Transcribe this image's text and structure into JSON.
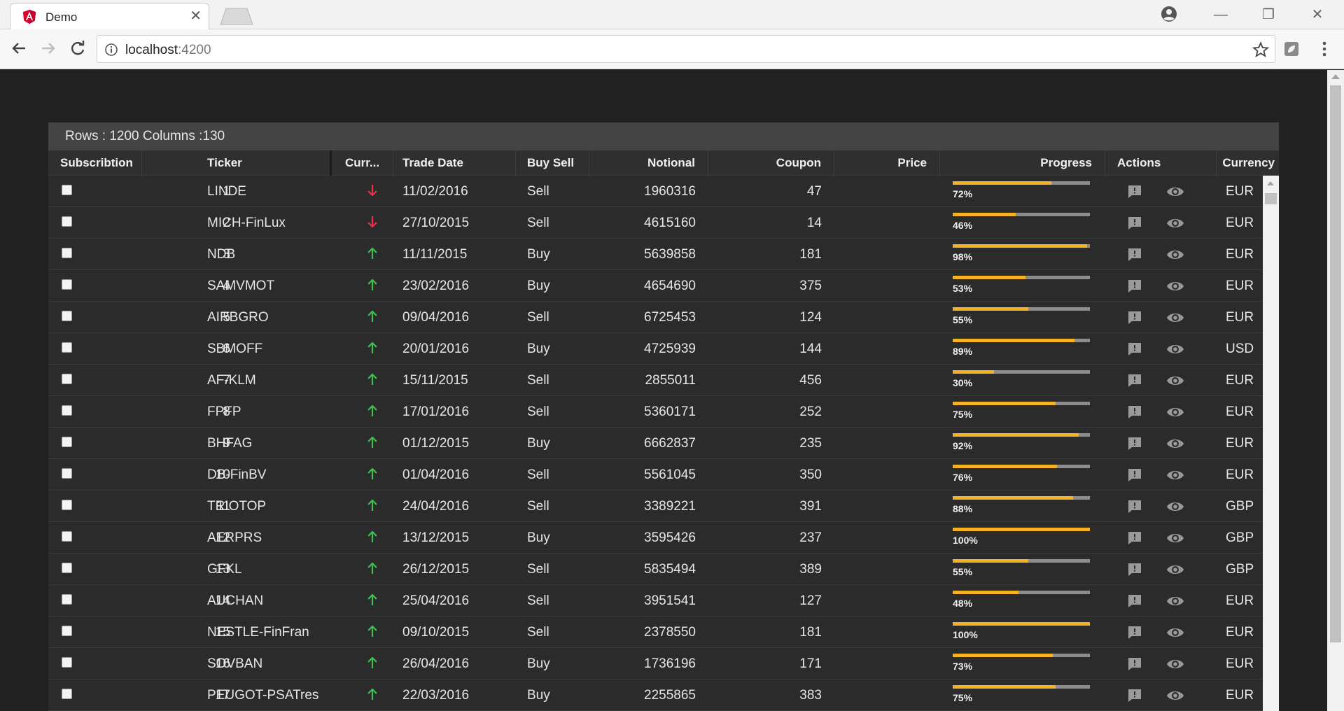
{
  "browser": {
    "tab_title": "Demo",
    "tab_close": "✕",
    "url_host": "localhost",
    "url_port": ":4200",
    "window_minimize": "—",
    "window_restore": "❐",
    "window_close": "✕"
  },
  "grid": {
    "status": "Rows : 1200 Columns :130",
    "headers": {
      "subscription": "Subscribtion",
      "index": "",
      "ticker": "Ticker",
      "currency_trend": "Curr...",
      "trade_date": "Trade Date",
      "buy_sell": "Buy Sell",
      "notional": "Notional",
      "coupon": "Coupon",
      "price": "Price",
      "progress": "Progress",
      "actions": "Actions",
      "currency": "Currency"
    },
    "colors": {
      "up": "#3fbf4f",
      "down": "#e8334a",
      "progress": "#f5b324"
    },
    "rows": [
      {
        "id": "1",
        "ticker": "LINDE",
        "trend": "down",
        "trade_date": "11/02/2016",
        "buy_sell": "Sell",
        "notional": "1960316",
        "coupon": "47",
        "progress": 72,
        "progress_label": "72%",
        "currency": "EUR"
      },
      {
        "id": "2",
        "ticker": "MICH-FinLux",
        "trend": "down",
        "trade_date": "27/10/2015",
        "buy_sell": "Sell",
        "notional": "4615160",
        "coupon": "14",
        "progress": 46,
        "progress_label": "46%",
        "currency": "EUR"
      },
      {
        "id": "3",
        "ticker": "NDB",
        "trend": "up",
        "trade_date": "11/11/2015",
        "buy_sell": "Buy",
        "notional": "5639858",
        "coupon": "181",
        "progress": 98,
        "progress_label": "98%",
        "currency": "EUR"
      },
      {
        "id": "4",
        "ticker": "SAMVMOT",
        "trend": "up",
        "trade_date": "23/02/2016",
        "buy_sell": "Buy",
        "notional": "4654690",
        "coupon": "375",
        "progress": 53,
        "progress_label": "53%",
        "currency": "EUR"
      },
      {
        "id": "5",
        "ticker": "AIRBGRO",
        "trend": "up",
        "trade_date": "09/04/2016",
        "buy_sell": "Sell",
        "notional": "6725453",
        "coupon": "124",
        "progress": 55,
        "progress_label": "55%",
        "currency": "EUR"
      },
      {
        "id": "6",
        "ticker": "SBMOFF",
        "trend": "up",
        "trade_date": "20/01/2016",
        "buy_sell": "Buy",
        "notional": "4725939",
        "coupon": "144",
        "progress": 89,
        "progress_label": "89%",
        "currency": "USD"
      },
      {
        "id": "7",
        "ticker": "AF-KLM",
        "trend": "up",
        "trade_date": "15/11/2015",
        "buy_sell": "Sell",
        "notional": "2855011",
        "coupon": "456",
        "progress": 30,
        "progress_label": "30%",
        "currency": "EUR"
      },
      {
        "id": "8",
        "ticker": "FPFP",
        "trend": "up",
        "trade_date": "17/01/2016",
        "buy_sell": "Sell",
        "notional": "5360171",
        "coupon": "252",
        "progress": 75,
        "progress_label": "75%",
        "currency": "EUR"
      },
      {
        "id": "9",
        "ticker": "BHFAG",
        "trend": "up",
        "trade_date": "01/12/2015",
        "buy_sell": "Buy",
        "notional": "6662837",
        "coupon": "235",
        "progress": 92,
        "progress_label": "92%",
        "currency": "EUR"
      },
      {
        "id": "10",
        "ticker": "DB-FinBV",
        "trend": "up",
        "trade_date": "01/04/2016",
        "buy_sell": "Sell",
        "notional": "5561045",
        "coupon": "350",
        "progress": 76,
        "progress_label": "76%",
        "currency": "EUR"
      },
      {
        "id": "11",
        "ticker": "TRIOTOP",
        "trend": "up",
        "trade_date": "24/04/2016",
        "buy_sell": "Sell",
        "notional": "3389221",
        "coupon": "391",
        "progress": 88,
        "progress_label": "88%",
        "currency": "GBP"
      },
      {
        "id": "12",
        "ticker": "AERPRS",
        "trend": "up",
        "trade_date": "13/12/2015",
        "buy_sell": "Buy",
        "notional": "3595426",
        "coupon": "237",
        "progress": 100,
        "progress_label": "100%",
        "currency": "GBP"
      },
      {
        "id": "13",
        "ticker": "GFKL",
        "trend": "up",
        "trade_date": "26/12/2015",
        "buy_sell": "Sell",
        "notional": "5835494",
        "coupon": "389",
        "progress": 55,
        "progress_label": "55%",
        "currency": "GBP"
      },
      {
        "id": "14",
        "ticker": "AUCHAN",
        "trend": "up",
        "trade_date": "25/04/2016",
        "buy_sell": "Sell",
        "notional": "3951541",
        "coupon": "127",
        "progress": 48,
        "progress_label": "48%",
        "currency": "EUR"
      },
      {
        "id": "15",
        "ticker": "NESTLE-FinFran",
        "trend": "up",
        "trade_date": "09/10/2015",
        "buy_sell": "Sell",
        "notional": "2378550",
        "coupon": "181",
        "progress": 100,
        "progress_label": "100%",
        "currency": "EUR"
      },
      {
        "id": "16",
        "ticker": "SOVBAN",
        "trend": "up",
        "trade_date": "26/04/2016",
        "buy_sell": "Buy",
        "notional": "1736196",
        "coupon": "171",
        "progress": 73,
        "progress_label": "73%",
        "currency": "EUR"
      },
      {
        "id": "17",
        "ticker": "PEUGOT-PSATres",
        "trend": "up",
        "trade_date": "22/03/2016",
        "buy_sell": "Buy",
        "notional": "2255865",
        "coupon": "383",
        "progress": 75,
        "progress_label": "75%",
        "currency": "EUR"
      }
    ]
  }
}
